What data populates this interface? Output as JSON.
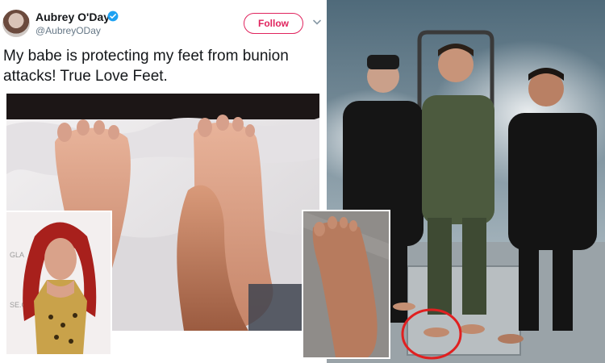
{
  "tweet": {
    "display_name": "Aubrey O'Day",
    "handle": "@AubreyODay",
    "follow_label": "Follow",
    "text_line1": "My babe is protecting my feet from bunion",
    "text_line2": "attacks!  True Love Feet."
  },
  "colors": {
    "brand_pink": "#e0245e",
    "verified_blue": "#1da1f2",
    "annotation_red": "#e02020"
  },
  "icons": {
    "verified": "verified-badge-icon",
    "chevron": "chevron-down-icon"
  }
}
